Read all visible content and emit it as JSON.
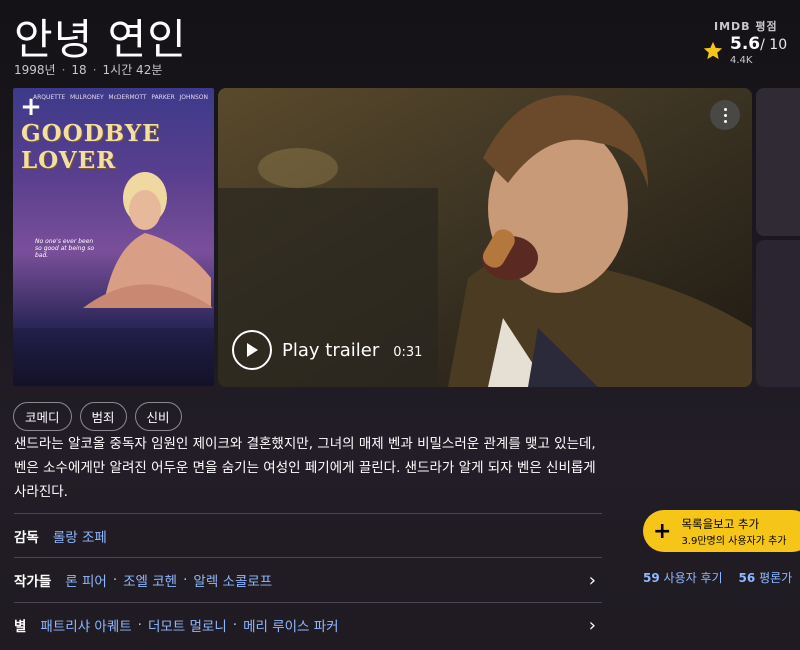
{
  "title": "안녕 연인",
  "meta": {
    "year": "1998년",
    "rating": "18",
    "runtime": "1시간 42분"
  },
  "imdb": {
    "label": "IMDB 평점",
    "score": "5.6",
    "max": "/ 10",
    "votes": "4.4K"
  },
  "poster": {
    "title": "GOODBYE LOVER",
    "credits": [
      "ARQUETTE",
      "MULRONEY",
      "McDERMOTT",
      "PARKER",
      "JOHNSON"
    ],
    "tagline": "No one's ever been so good at being so bad."
  },
  "trailer": {
    "label": "Play trailer",
    "duration": "0:31"
  },
  "genres": [
    "코메디",
    "범죄",
    "신비"
  ],
  "description": "샌드라는 알코올 중독자 임원인 제이크와 결혼했지만, 그녀의 매제 벤과 비밀스러운 관계를 맺고 있는데, 벤은 소수에게만 알려진 어두운 면을 숨기는 여성인 페기에게 끌린다. 샌드라가 알게 되자 벤은 신비롭게 사라진다.",
  "credits": {
    "director_label": "감독",
    "directors": [
      "롤랑 조페"
    ],
    "writers_label": "작가들",
    "writers": [
      "론 피어",
      "조엘 코헨",
      "알렉 소콜로프"
    ],
    "stars_label": "별",
    "stars": [
      "패트리샤 아퀘트",
      "더모트 멀로니",
      "메리 루이스 파커"
    ]
  },
  "watchlist": {
    "line1": "목록을보고 추가",
    "line2": "3.9만명의 사용자가 추가"
  },
  "reviews": {
    "user_count": "59",
    "user_label": "사용자 후기",
    "critic_count": "56",
    "critic_label": "평론가"
  },
  "colors": {
    "accent": "#f5c518",
    "link": "#8fb8ff"
  }
}
